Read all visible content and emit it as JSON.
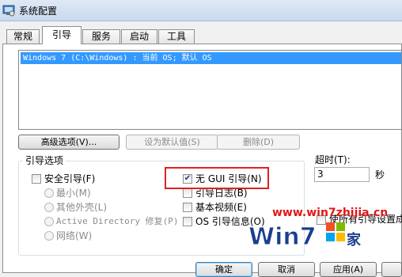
{
  "window": {
    "title": "系统配置"
  },
  "tabs": [
    {
      "label": "常规"
    },
    {
      "label": "引导"
    },
    {
      "label": "服务"
    },
    {
      "label": "启动"
    },
    {
      "label": "工具"
    }
  ],
  "os_list": {
    "items": [
      "Windows 7 (C:\\Windows) : 当前 OS; 默认 OS"
    ]
  },
  "boot_buttons": {
    "advanced": "高级选项(V)...",
    "set_default": "设为默认值(S)",
    "delete": "删除(D)"
  },
  "boot_options": {
    "group_label": "引导选项",
    "safe_boot": {
      "label": "安全引导(F)",
      "checked": false
    },
    "radios": [
      {
        "label": "最小(M)"
      },
      {
        "label": "其他外壳(L)"
      },
      {
        "label": "Active Directory 修复(P)"
      },
      {
        "label": "网络(W)"
      }
    ],
    "checks": [
      {
        "label": "无 GUI 引导(N)",
        "checked": true
      },
      {
        "label": "引导日志(B)",
        "checked": false
      },
      {
        "label": "基本视频(E)",
        "checked": false
      },
      {
        "label": "OS 引导信息(O)",
        "checked": false
      }
    ]
  },
  "timeout": {
    "label": "超时(T):",
    "value": "3",
    "unit": "秒"
  },
  "permanent": {
    "label": "使所有引导设置成"
  },
  "dialog_buttons": {
    "ok": "确定",
    "cancel": "取消",
    "apply": "应用(A)"
  },
  "watermark": {
    "url": "www.win7zhijia.cn",
    "logo_text": "Win7",
    "logo_suffix": "家"
  },
  "colors": {
    "highlight": "#e02020",
    "selection": "#3399ff",
    "watermark": "#e01818"
  }
}
